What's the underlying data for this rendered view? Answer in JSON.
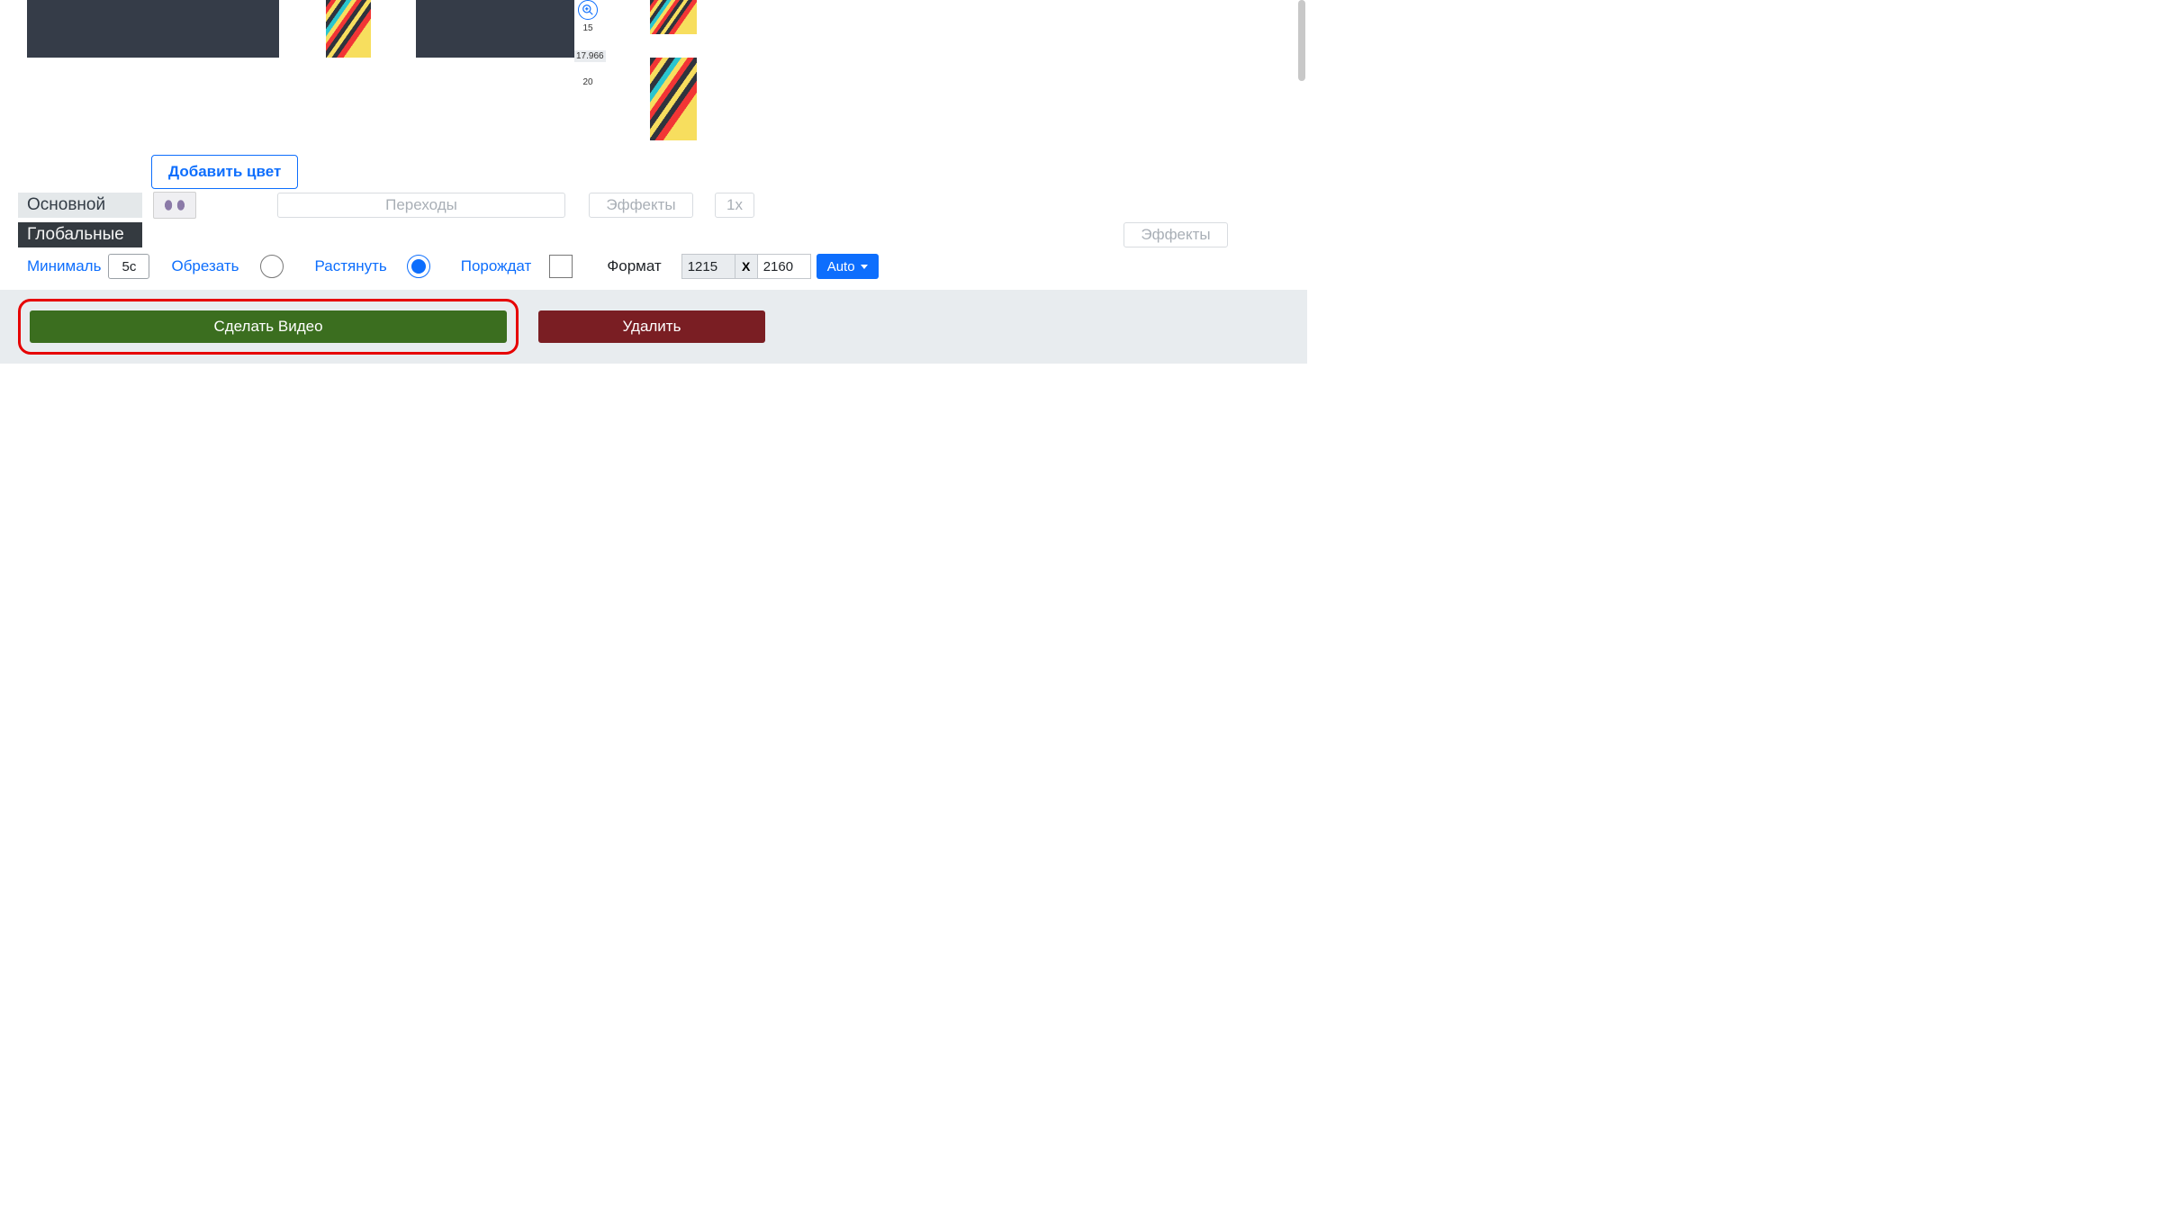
{
  "zoom": {
    "mark15": "15",
    "value": "17.966",
    "mark20": "20"
  },
  "buttons": {
    "add_color": "Добавить цвет",
    "make_video": "Сделать Видео",
    "delete": "Удалить",
    "auto": "Auto"
  },
  "tabs": {
    "main": "Основной",
    "global": "Глобальные"
  },
  "pills": {
    "transitions": "Переходы",
    "effects_top": "Эффекты",
    "speed": "1x",
    "effects_bottom": "Эффекты"
  },
  "options": {
    "minimal_label": "Минималь",
    "minimal_value": "5с",
    "crop_label": "Обрезать",
    "stretch_label": "Растянуть",
    "generate_label": "Порождат",
    "format_label": "Формат",
    "width": "1215",
    "sep": "X",
    "height": "2160"
  }
}
